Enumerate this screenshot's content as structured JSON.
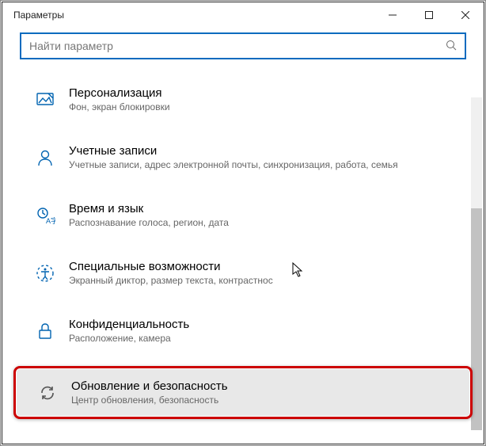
{
  "window": {
    "title": "Параметры"
  },
  "search": {
    "placeholder": "Найти параметр"
  },
  "items": [
    {
      "title": "Персонализация",
      "subtitle": "Фон, экран блокировки"
    },
    {
      "title": "Учетные записи",
      "subtitle": "Учетные записи, адрес электронной почты, синхронизация, работа, семья"
    },
    {
      "title": "Время и язык",
      "subtitle": "Распознавание голоса, регион, дата"
    },
    {
      "title": "Специальные возможности",
      "subtitle": "Экранный диктор, размер текста, контрастнос"
    },
    {
      "title": "Конфиденциальность",
      "subtitle": "Расположение, камера"
    },
    {
      "title": "Обновление и безопасность",
      "subtitle": "Центр обновления, безопасность"
    }
  ]
}
